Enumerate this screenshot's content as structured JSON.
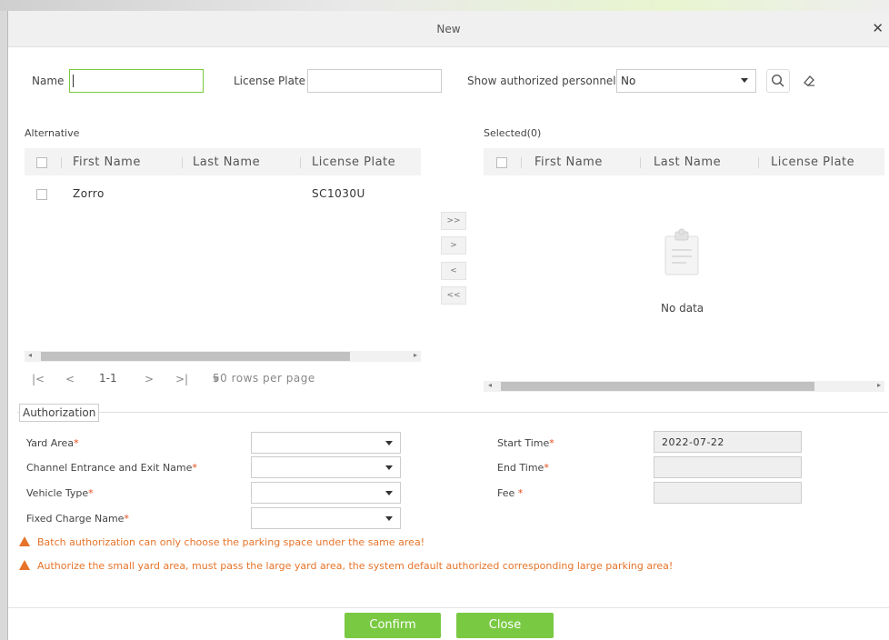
{
  "dialog": {
    "title": "New"
  },
  "filters": {
    "name_label": "Name",
    "name_value": "",
    "license_label": "License Plate",
    "license_value": "",
    "show_auth_label": "Show authorized personnel",
    "show_auth_value": "No"
  },
  "alternative": {
    "title": "Alternative",
    "columns": [
      "First Name",
      "Last Name",
      "License Plate"
    ],
    "rows": [
      {
        "first": "Zorro",
        "last": "",
        "plate": "SC1030U"
      }
    ],
    "pager": {
      "first": "|<",
      "prev": "<",
      "range": "1-1",
      "next": ">",
      "last": ">|",
      "rows_per_page": "50 rows per page"
    }
  },
  "selected": {
    "title": "Selected(0)",
    "columns": [
      "First Name",
      "Last Name",
      "License Plate"
    ],
    "empty_text": "No data"
  },
  "move_buttons": [
    ">>",
    ">",
    "<",
    "<<"
  ],
  "authorization": {
    "legend": "Authorization",
    "yard_area_label": "Yard Area",
    "channel_label": "Channel Entrance and Exit Name",
    "vehicle_type_label": "Vehicle Type",
    "fixed_charge_label": "Fixed Charge Name",
    "start_time_label": "Start Time",
    "start_time_value": "2022-07-22",
    "end_time_label": "End Time",
    "end_time_value": "",
    "fee_label": "Fee",
    "fee_value": "",
    "required_mark": "*",
    "warning_1": "Batch authorization can only choose the parking space under the same area!",
    "warning_2": "Authorize the small yard area, must pass the large yard area, the system default authorized corresponding large parking area!"
  },
  "footer": {
    "confirm": "Confirm",
    "close": "Close"
  },
  "colors": {
    "accent": "#7ac943",
    "warning": "#e6742a",
    "required": "#e64a19"
  }
}
